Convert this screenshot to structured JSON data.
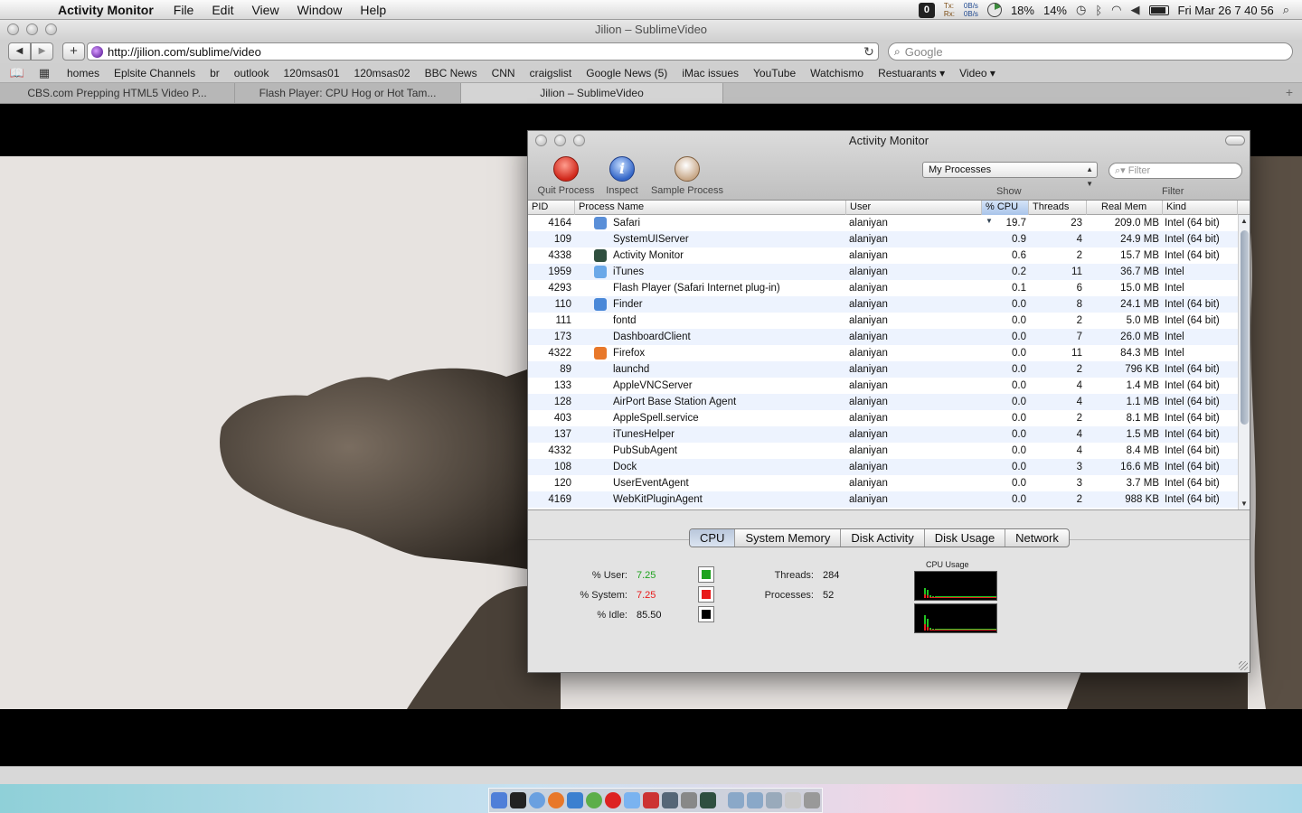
{
  "menubar": {
    "app_name": "Activity Monitor",
    "items": [
      "File",
      "Edit",
      "View",
      "Window",
      "Help"
    ],
    "net_tx_label": "Tx:",
    "net_rx_label": "Rx:",
    "net_tx": "0B/s",
    "net_rx": "0B/s",
    "cpu_percent": "18%",
    "mem_percent": "14%",
    "clock": "Fri Mar 26  7 40 56"
  },
  "safari": {
    "title": "Jilion – SublimeVideo",
    "url": "http://jilion.com/sublime/video",
    "search_placeholder": "Google",
    "bookmarks": [
      "homes",
      "Eplsite Channels",
      "br",
      "outlook",
      "120msas01",
      "120msas02",
      "BBC News",
      "CNN",
      "craigslist",
      "Google News (5)",
      "iMac issues",
      "YouTube",
      "Watchismo",
      "Restuarants ▾",
      "Video ▾"
    ],
    "tabs": [
      {
        "label": "CBS.com Prepping HTML5 Video P...",
        "active": false
      },
      {
        "label": "Flash Player: CPU Hog or Hot Tam...",
        "active": false
      },
      {
        "label": "Jilion – SublimeVideo",
        "active": true
      }
    ]
  },
  "activity_monitor": {
    "title": "Activity Monitor",
    "toolbar": {
      "quit_label": "Quit Process",
      "inspect_label": "Inspect",
      "sample_label": "Sample Process",
      "show_label": "Show",
      "filter_label": "Filter",
      "process_filter_value": "My Processes",
      "filter_placeholder": "Filter"
    },
    "columns": [
      "PID",
      "Process Name",
      "User",
      "% CPU",
      "Threads",
      "Real Mem",
      "Kind"
    ],
    "sorted_column": "% CPU",
    "processes": [
      {
        "pid": "4164",
        "name": "Safari",
        "user": "alaniyan",
        "cpu": "19.7",
        "threads": "23",
        "mem": "209.0 MB",
        "kind": "Intel (64 bit)",
        "icon": "safari-icon",
        "icon_color": "#5a8fd8"
      },
      {
        "pid": "109",
        "name": "SystemUIServer",
        "user": "alaniyan",
        "cpu": "0.9",
        "threads": "4",
        "mem": "24.9 MB",
        "kind": "Intel (64 bit)",
        "icon": "",
        "icon_color": ""
      },
      {
        "pid": "4338",
        "name": "Activity Monitor",
        "user": "alaniyan",
        "cpu": "0.6",
        "threads": "2",
        "mem": "15.7 MB",
        "kind": "Intel (64 bit)",
        "icon": "activity-monitor-icon",
        "icon_color": "#2f4f3f"
      },
      {
        "pid": "1959",
        "name": "iTunes",
        "user": "alaniyan",
        "cpu": "0.2",
        "threads": "11",
        "mem": "36.7 MB",
        "kind": "Intel",
        "icon": "itunes-icon",
        "icon_color": "#6aa8e8"
      },
      {
        "pid": "4293",
        "name": "Flash Player (Safari Internet plug-in)",
        "user": "alaniyan",
        "cpu": "0.1",
        "threads": "6",
        "mem": "15.0 MB",
        "kind": "Intel",
        "icon": "",
        "icon_color": ""
      },
      {
        "pid": "110",
        "name": "Finder",
        "user": "alaniyan",
        "cpu": "0.0",
        "threads": "8",
        "mem": "24.1 MB",
        "kind": "Intel (64 bit)",
        "icon": "finder-icon",
        "icon_color": "#4a88d8"
      },
      {
        "pid": "111",
        "name": "fontd",
        "user": "alaniyan",
        "cpu": "0.0",
        "threads": "2",
        "mem": "5.0 MB",
        "kind": "Intel (64 bit)",
        "icon": "",
        "icon_color": ""
      },
      {
        "pid": "173",
        "name": "DashboardClient",
        "user": "alaniyan",
        "cpu": "0.0",
        "threads": "7",
        "mem": "26.0 MB",
        "kind": "Intel",
        "icon": "",
        "icon_color": ""
      },
      {
        "pid": "4322",
        "name": "Firefox",
        "user": "alaniyan",
        "cpu": "0.0",
        "threads": "11",
        "mem": "84.3 MB",
        "kind": "Intel",
        "icon": "firefox-icon",
        "icon_color": "#e8782a"
      },
      {
        "pid": "89",
        "name": "launchd",
        "user": "alaniyan",
        "cpu": "0.0",
        "threads": "2",
        "mem": "796 KB",
        "kind": "Intel (64 bit)",
        "icon": "",
        "icon_color": ""
      },
      {
        "pid": "133",
        "name": "AppleVNCServer",
        "user": "alaniyan",
        "cpu": "0.0",
        "threads": "4",
        "mem": "1.4 MB",
        "kind": "Intel (64 bit)",
        "icon": "",
        "icon_color": ""
      },
      {
        "pid": "128",
        "name": "AirPort Base Station Agent",
        "user": "alaniyan",
        "cpu": "0.0",
        "threads": "4",
        "mem": "1.1 MB",
        "kind": "Intel (64 bit)",
        "icon": "",
        "icon_color": ""
      },
      {
        "pid": "403",
        "name": "AppleSpell.service",
        "user": "alaniyan",
        "cpu": "0.0",
        "threads": "2",
        "mem": "8.1 MB",
        "kind": "Intel (64 bit)",
        "icon": "",
        "icon_color": ""
      },
      {
        "pid": "137",
        "name": "iTunesHelper",
        "user": "alaniyan",
        "cpu": "0.0",
        "threads": "4",
        "mem": "1.5 MB",
        "kind": "Intel (64 bit)",
        "icon": "",
        "icon_color": ""
      },
      {
        "pid": "4332",
        "name": "PubSubAgent",
        "user": "alaniyan",
        "cpu": "0.0",
        "threads": "4",
        "mem": "8.4 MB",
        "kind": "Intel (64 bit)",
        "icon": "",
        "icon_color": ""
      },
      {
        "pid": "108",
        "name": "Dock",
        "user": "alaniyan",
        "cpu": "0.0",
        "threads": "3",
        "mem": "16.6 MB",
        "kind": "Intel (64 bit)",
        "icon": "",
        "icon_color": ""
      },
      {
        "pid": "120",
        "name": "UserEventAgent",
        "user": "alaniyan",
        "cpu": "0.0",
        "threads": "3",
        "mem": "3.7 MB",
        "kind": "Intel (64 bit)",
        "icon": "",
        "icon_color": ""
      },
      {
        "pid": "4169",
        "name": "WebKitPluginAgent",
        "user": "alaniyan",
        "cpu": "0.0",
        "threads": "2",
        "mem": "988 KB",
        "kind": "Intel (64 bit)",
        "icon": "",
        "icon_color": ""
      }
    ],
    "tabs": [
      {
        "label": "CPU",
        "active": true
      },
      {
        "label": "System Memory",
        "active": false
      },
      {
        "label": "Disk Activity",
        "active": false
      },
      {
        "label": "Disk Usage",
        "active": false
      },
      {
        "label": "Network",
        "active": false
      }
    ],
    "cpu_stats": {
      "user_label": "% User:",
      "user_value": "7.25",
      "user_color": "#1fa31f",
      "system_label": "% System:",
      "system_value": "7.25",
      "system_color": "#e81a1a",
      "idle_label": "% Idle:",
      "idle_value": "85.50",
      "idle_color": "#000000",
      "threads_label": "Threads:",
      "threads_value": "284",
      "processes_label": "Processes:",
      "processes_value": "52",
      "graph_title": "CPU Usage"
    }
  }
}
